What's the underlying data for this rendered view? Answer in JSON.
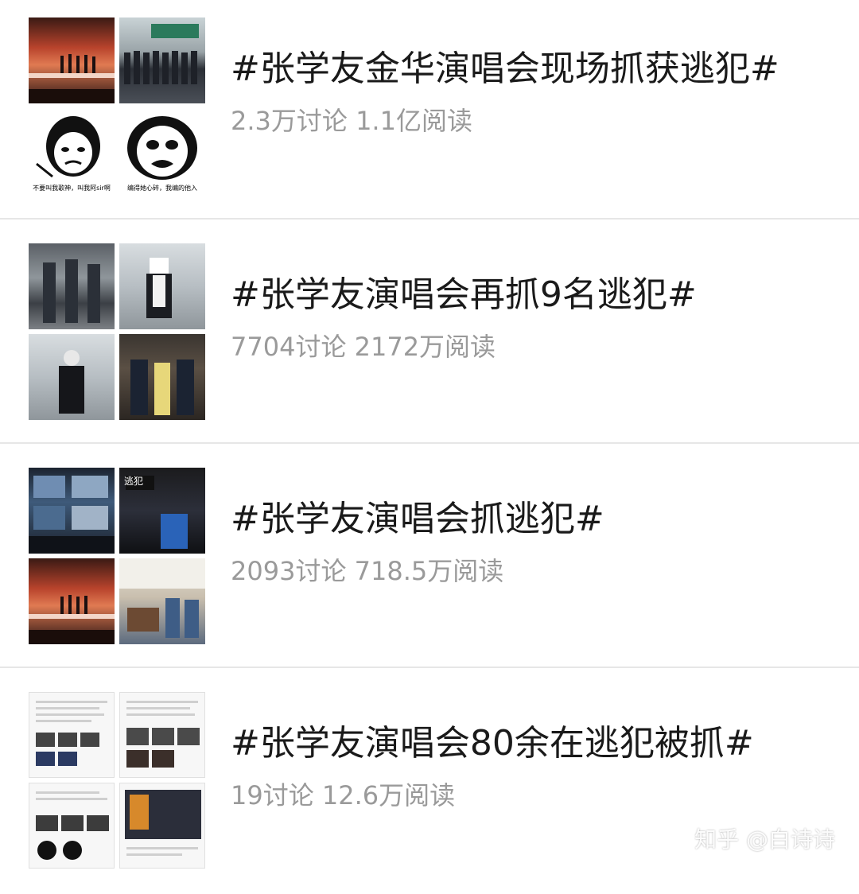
{
  "items": [
    {
      "title": "#张学友金华演唱会现场抓获逃犯#",
      "stats": "2.3万讨论 1.1亿阅读",
      "thumb_captions": [
        "不要叫我歌神，叫我阿sir啊",
        "编得她心碎，我编的他入"
      ]
    },
    {
      "title": "#张学友演唱会再抓9名逃犯#",
      "stats": "7704讨论 2172万阅读"
    },
    {
      "title": "#张学友演唱会抓逃犯#",
      "stats": "2093讨论 718.5万阅读",
      "thumb_captions": [
        "逃犯"
      ]
    },
    {
      "title": "#张学友演唱会80余在逃犯被抓#",
      "stats": "19讨论 12.6万阅读"
    }
  ],
  "watermark": "知乎 @白诗诗"
}
